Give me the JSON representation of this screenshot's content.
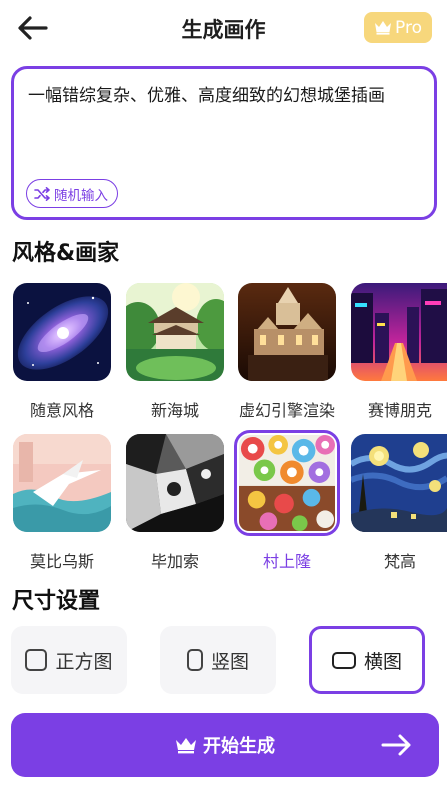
{
  "header": {
    "title": "生成画作",
    "pro_label": "Pro",
    "pro_color": "#f7d77c"
  },
  "prompt": {
    "text": "一幅错综复杂、优雅、高度细致的幻想城堡插画",
    "random_label": "随机输入"
  },
  "styles": {
    "section_title": "风格&画家",
    "items": [
      {
        "label": "随意风格",
        "icon": "galaxy-thumbnail",
        "selected": false
      },
      {
        "label": "新海城",
        "icon": "shrine-forest-thumbnail",
        "selected": false
      },
      {
        "label": "虚幻引擎渲染",
        "icon": "castle-render-thumbnail",
        "selected": false
      },
      {
        "label": "赛博朋克",
        "icon": "neon-city-thumbnail",
        "selected": false
      },
      {
        "label": "莫比乌斯",
        "icon": "moebius-bird-thumbnail",
        "selected": false
      },
      {
        "label": "毕加索",
        "icon": "cubist-thumbnail",
        "selected": false
      },
      {
        "label": "村上隆",
        "icon": "flowers-thumbnail",
        "selected": true
      },
      {
        "label": "梵高",
        "icon": "starry-night-thumbnail",
        "selected": false
      }
    ]
  },
  "size": {
    "section_title": "尺寸设置",
    "options": [
      {
        "label": "正方图",
        "selected": false
      },
      {
        "label": "竖图",
        "selected": false
      },
      {
        "label": "横图",
        "selected": true
      }
    ]
  },
  "generate": {
    "label": "开始生成"
  },
  "colors": {
    "accent": "#7b3fe4",
    "background": "#ffffff"
  }
}
